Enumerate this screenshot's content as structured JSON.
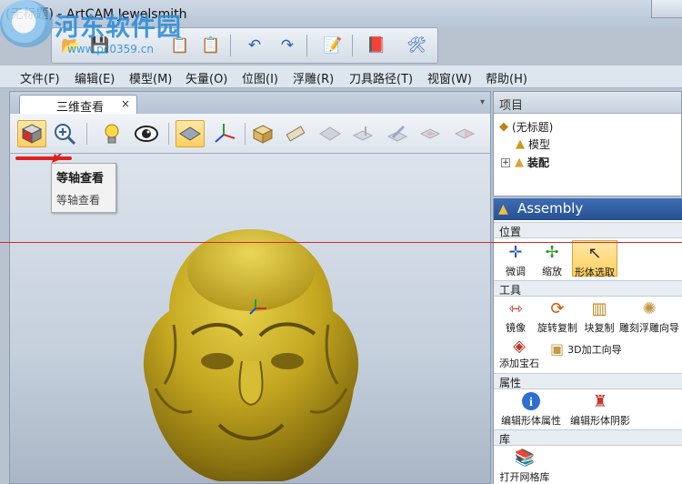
{
  "window": {
    "title": "(无标题) - ArtCAM Jewelsmith"
  },
  "watermark": {
    "text": "河东软件园",
    "url": "www.pc0359.cn"
  },
  "menu": [
    "文件(F)",
    "编辑(E)",
    "模型(M)",
    "矢量(O)",
    "位图(I)",
    "浮雕(R)",
    "刀具路径(T)",
    "视窗(W)",
    "帮助(H)"
  ],
  "view_tab": {
    "label": "三维查看",
    "close": "×",
    "dropdown": "▾"
  },
  "tooltip": {
    "title": "等轴查看",
    "description": "等轴查看"
  },
  "project_panel": {
    "title": "项目",
    "tree": [
      {
        "label": "(无标题)",
        "icon": "project-icon"
      },
      {
        "label": "模型",
        "icon": "model-icon"
      },
      {
        "label": "装配",
        "icon": "assembly-icon",
        "expander": "+"
      }
    ]
  },
  "assembly": {
    "title": "Assembly",
    "sections": {
      "position": "位置",
      "tools": "工具",
      "properties": "属性",
      "library": "库"
    },
    "position_tools": [
      "微调",
      "缩放",
      "形体选取"
    ],
    "tools": [
      "镜像",
      "旋转复制",
      "块复制",
      "雕刻浮雕向导"
    ],
    "tools_row2": [
      "添加宝石",
      "3D加工向导"
    ],
    "property_tools": [
      "编辑形体属性",
      "编辑形体阴影"
    ],
    "library_tools": [
      "打开网格库"
    ]
  },
  "colors": {
    "accent": "#274f93",
    "active": "#ffcf5e",
    "model": "#b89a1e",
    "guide": "#d42a2a"
  }
}
